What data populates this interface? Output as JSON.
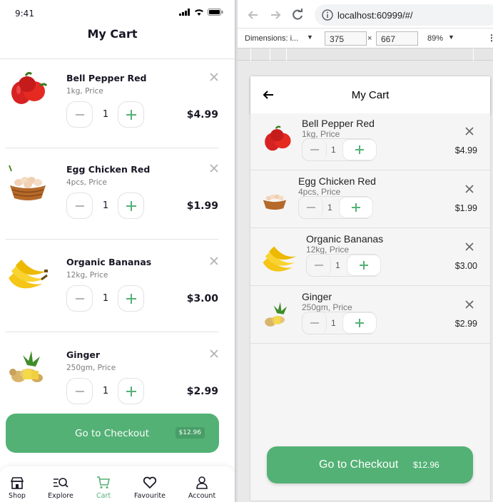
{
  "phone": {
    "status_time": "9:41",
    "title": "My Cart",
    "items": [
      {
        "name": "Bell Pepper Red",
        "sub": "1kg, Price",
        "qty": "1",
        "price": "$4.99"
      },
      {
        "name": "Egg Chicken Red",
        "sub": "4pcs, Price",
        "qty": "1",
        "price": "$1.99"
      },
      {
        "name": "Organic Bananas",
        "sub": "12kg, Price",
        "qty": "1",
        "price": "$3.00"
      },
      {
        "name": "Ginger",
        "sub": "250gm, Price",
        "qty": "1",
        "price": "$2.99"
      }
    ],
    "checkout": {
      "label": "Go to Checkout",
      "total": "$12.96"
    },
    "nav": [
      {
        "label": "Shop",
        "icon": "store-icon",
        "active": false
      },
      {
        "label": "Explore",
        "icon": "explore-icon",
        "active": false
      },
      {
        "label": "Cart",
        "icon": "cart-icon",
        "active": true
      },
      {
        "label": "Favourite",
        "icon": "heart-icon",
        "active": false
      },
      {
        "label": "Account",
        "icon": "user-icon",
        "active": false
      }
    ]
  },
  "browser": {
    "url": "localhost:60999/#/",
    "devtools": {
      "dimensions_label": "Dimensions: i...",
      "width": "375",
      "height": "667",
      "times": "×",
      "zoom": "89%"
    },
    "app": {
      "title": "My Cart",
      "items": [
        {
          "name": "Bell Pepper Red",
          "sub": "1kg, Price",
          "qty": "1",
          "price": "$4.99"
        },
        {
          "name": "Egg Chicken Red",
          "sub": "4pcs, Price",
          "qty": "1",
          "price": "$1.99"
        },
        {
          "name": "Organic Bananas",
          "sub": "12kg, Price",
          "qty": "1",
          "price": "$3.00"
        },
        {
          "name": "Ginger",
          "sub": "250gm, Price",
          "qty": "1",
          "price": "$2.99"
        }
      ],
      "checkout": {
        "label": "Go to Checkout",
        "total": "$12.96"
      }
    }
  },
  "colors": {
    "accent": "#53b175",
    "text": "#181725",
    "muted": "#7c7c7c",
    "divider": "#e2e2e2"
  }
}
